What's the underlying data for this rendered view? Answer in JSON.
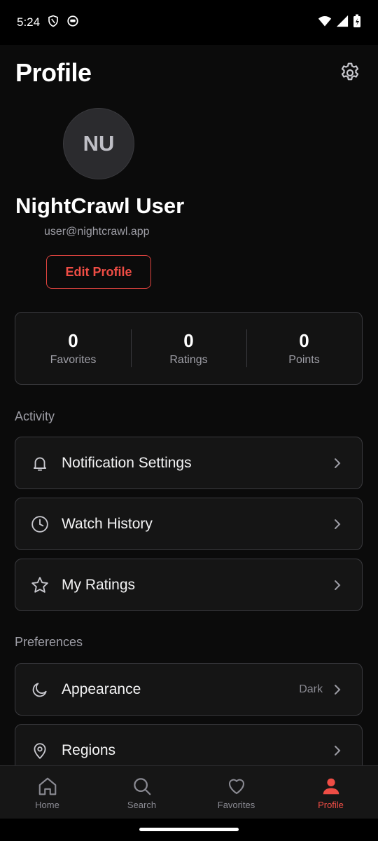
{
  "status_bar": {
    "time": "5:24"
  },
  "header": {
    "title": "Profile"
  },
  "profile": {
    "initials": "NU",
    "name": "NightCrawl User",
    "email": "user@nightcrawl.app",
    "edit_label": "Edit Profile"
  },
  "stats": [
    {
      "value": "0",
      "label": "Favorites"
    },
    {
      "value": "0",
      "label": "Ratings"
    },
    {
      "value": "0",
      "label": "Points"
    }
  ],
  "sections": {
    "activity": "Activity",
    "preferences": "Preferences"
  },
  "activity_items": [
    {
      "label": "Notification Settings",
      "icon": "bell-icon"
    },
    {
      "label": "Watch History",
      "icon": "clock-icon"
    },
    {
      "label": "My Ratings",
      "icon": "star-icon"
    }
  ],
  "preference_items": [
    {
      "label": "Appearance",
      "value": "Dark",
      "icon": "moon-icon"
    },
    {
      "label": "Regions",
      "icon": "location-pin-icon"
    }
  ],
  "nav": [
    {
      "label": "Home",
      "icon": "home-icon"
    },
    {
      "label": "Search",
      "icon": "search-icon"
    },
    {
      "label": "Favorites",
      "icon": "heart-icon"
    },
    {
      "label": "Profile",
      "icon": "person-icon",
      "active": true
    }
  ],
  "colors": {
    "accent": "#ef4d45",
    "background": "#0b0b0b"
  }
}
